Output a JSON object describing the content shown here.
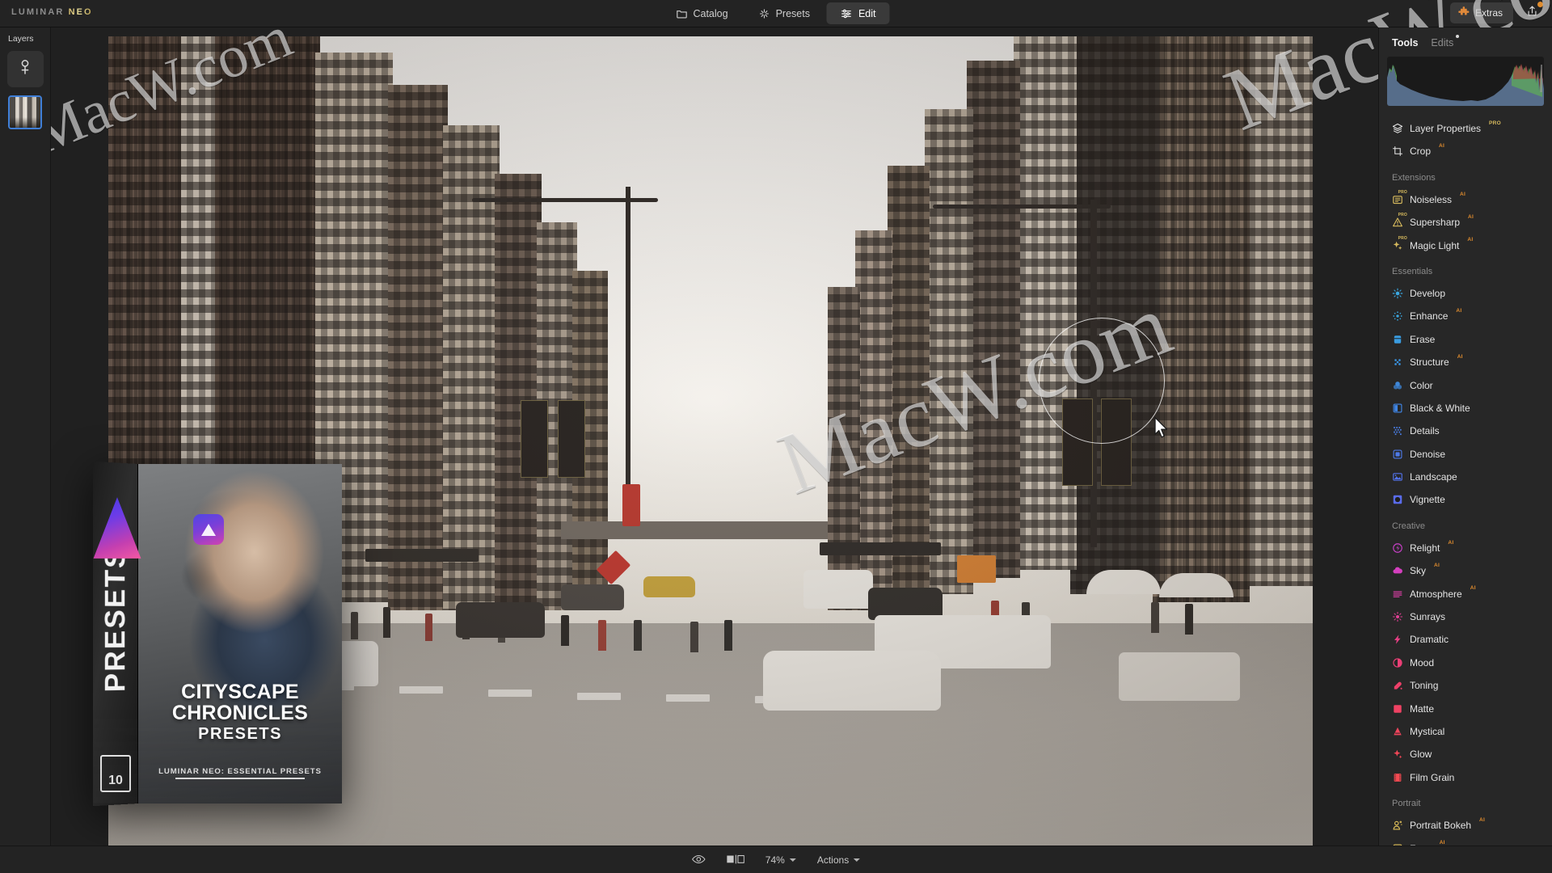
{
  "app": {
    "brand_prefix": "LUMINAR ",
    "brand_suffix": "NEO"
  },
  "topbar": {
    "tabs": [
      {
        "label": "Catalog",
        "icon": "folder-icon",
        "active": false
      },
      {
        "label": "Presets",
        "icon": "sparkle-icon",
        "active": false
      },
      {
        "label": "Edit",
        "icon": "sliders-icon",
        "active": true
      }
    ],
    "extras_label": "Extras",
    "extras_icon": "puzzle-piece-icon",
    "share_icon": "share-export-icon",
    "share_badge": true
  },
  "layers_panel": {
    "title": "Layers",
    "add_layer_icon": "add-layer-icon",
    "layer_thumbnail_selected": true
  },
  "tools_panel": {
    "tabs": [
      {
        "label": "Tools",
        "active": true,
        "dot": false
      },
      {
        "label": "Edits",
        "active": false,
        "dot": true
      }
    ],
    "histogram": {
      "label": "histogram",
      "shape": "u-curve",
      "colors": {
        "fill": "#5b7494",
        "highlight_green": "#5fae57",
        "highlight_red": "#a8483c"
      }
    },
    "top_items": [
      {
        "label": "Layer Properties",
        "icon": "layers-stack-icon",
        "badge": "PRO",
        "badge_type": "pro",
        "color": "#e6e6e6"
      },
      {
        "label": "Crop",
        "icon": "crop-icon",
        "badge": "AI",
        "badge_type": "ai",
        "color": "#e6e6e6"
      }
    ],
    "sections": [
      {
        "title": "Extensions",
        "items": [
          {
            "label": "Noiseless",
            "icon": "noiseless-icon",
            "badge": "AI",
            "badge_type": "ai",
            "icon_tag": "PRO",
            "color": "#d8bb5e"
          },
          {
            "label": "Supersharp",
            "icon": "supersharp-icon",
            "badge": "AI",
            "badge_type": "ai",
            "icon_tag": "PRO",
            "color": "#d8bb5e"
          },
          {
            "label": "Magic Light",
            "icon": "magic-light-icon",
            "badge": "AI",
            "badge_type": "ai",
            "icon_tag": "PRO",
            "color": "#d8bb5e"
          }
        ]
      },
      {
        "title": "Essentials",
        "items": [
          {
            "label": "Develop",
            "icon": "develop-icon",
            "badge": "",
            "badge_type": "",
            "color": "#3aa7e0"
          },
          {
            "label": "Enhance",
            "icon": "enhance-icon",
            "badge": "AI",
            "badge_type": "ai",
            "color": "#3aa7e0"
          },
          {
            "label": "Erase",
            "icon": "erase-icon",
            "badge": "",
            "badge_type": "",
            "color": "#3a9ce0"
          },
          {
            "label": "Structure",
            "icon": "structure-icon",
            "badge": "AI",
            "badge_type": "ai",
            "color": "#3a93e0"
          },
          {
            "label": "Color",
            "icon": "color-icon",
            "badge": "",
            "badge_type": "",
            "color": "#3f8ce2"
          },
          {
            "label": "Black & White",
            "icon": "blackwhite-icon",
            "badge": "",
            "badge_type": "",
            "color": "#3f85e4"
          },
          {
            "label": "Details",
            "icon": "details-icon",
            "badge": "",
            "badge_type": "",
            "color": "#4a7ee6"
          },
          {
            "label": "Denoise",
            "icon": "denoise-icon",
            "badge": "",
            "badge_type": "",
            "color": "#4d79e8"
          },
          {
            "label": "Landscape",
            "icon": "landscape-icon",
            "badge": "",
            "badge_type": "",
            "color": "#5272ea"
          },
          {
            "label": "Vignette",
            "icon": "vignette-icon",
            "badge": "",
            "badge_type": "",
            "color": "#5a6ceb"
          }
        ]
      },
      {
        "title": "Creative",
        "items": [
          {
            "label": "Relight",
            "icon": "relight-icon",
            "badge": "AI",
            "badge_type": "ai",
            "color": "#c840c8"
          },
          {
            "label": "Sky",
            "icon": "sky-icon",
            "badge": "AI",
            "badge_type": "ai",
            "color": "#d53fbe"
          },
          {
            "label": "Atmosphere",
            "icon": "atmosphere-icon",
            "badge": "AI",
            "badge_type": "ai",
            "color": "#de3fa8"
          },
          {
            "label": "Sunrays",
            "icon": "sunrays-icon",
            "badge": "",
            "badge_type": "",
            "color": "#e33f95"
          },
          {
            "label": "Dramatic",
            "icon": "dramatic-icon",
            "badge": "",
            "badge_type": "",
            "color": "#e73f84"
          },
          {
            "label": "Mood",
            "icon": "mood-icon",
            "badge": "",
            "badge_type": "",
            "color": "#ea3f76"
          },
          {
            "label": "Toning",
            "icon": "toning-icon",
            "badge": "",
            "badge_type": "",
            "color": "#ed4069"
          },
          {
            "label": "Matte",
            "icon": "matte-icon",
            "badge": "",
            "badge_type": "",
            "color": "#ef4263"
          },
          {
            "label": "Mystical",
            "icon": "mystical-icon",
            "badge": "",
            "badge_type": "",
            "color": "#f0455d"
          },
          {
            "label": "Glow",
            "icon": "glow-icon",
            "badge": "",
            "badge_type": "",
            "color": "#f24757"
          },
          {
            "label": "Film Grain",
            "icon": "filmgrain-icon",
            "badge": "",
            "badge_type": "",
            "color": "#f34a52"
          }
        ]
      },
      {
        "title": "Portrait",
        "items": [
          {
            "label": "Portrait Bokeh",
            "icon": "portrait-bokeh-icon",
            "badge": "AI",
            "badge_type": "ai",
            "color": "#e0c05a"
          },
          {
            "label": "Face",
            "icon": "face-icon",
            "badge": "AI",
            "badge_type": "ai",
            "color": "#e0c05a"
          }
        ]
      }
    ]
  },
  "bottombar": {
    "preview_eye_icon": "eye-icon",
    "compare_icon": "before-after-compare-icon",
    "zoom_level": "74%",
    "actions_label": "Actions"
  },
  "preset_box_overlay": {
    "spine_text": "PRESETS",
    "count_badge": "10",
    "title_line1": "CITYSCAPE",
    "title_line2": "CHRONICLES",
    "title_line3": "PRESETS",
    "subtitle": "LUMINAR NEO: ESSENTIAL PRESETS"
  },
  "watermarks": {
    "text": "MacW.com"
  },
  "canvas": {
    "cursor_tool": "brush-circle-cursor"
  }
}
